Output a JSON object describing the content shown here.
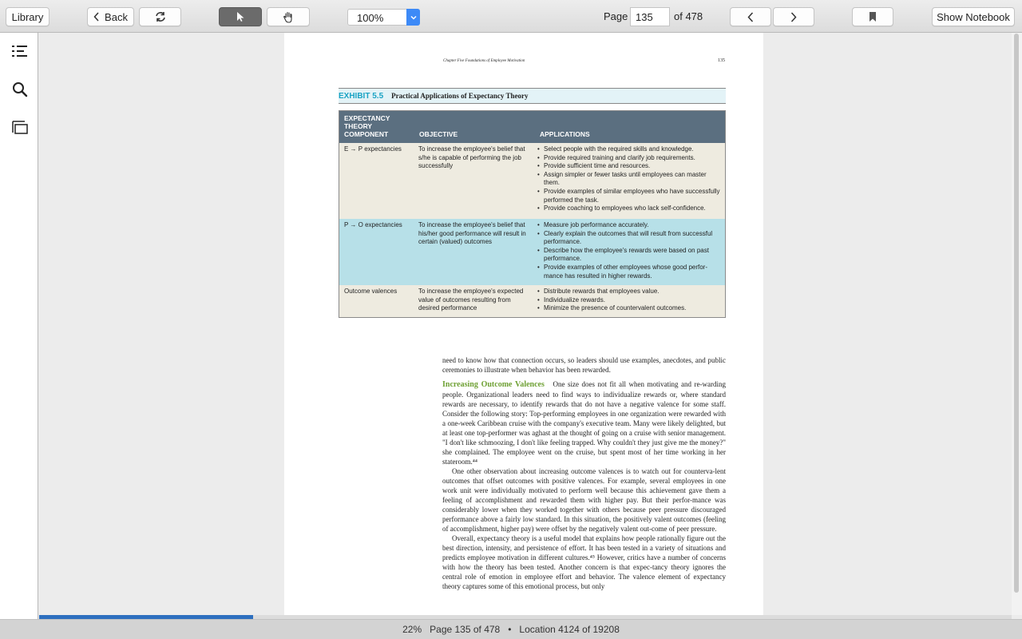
{
  "toolbar": {
    "library": "Library",
    "back": "Back",
    "zoom": "100%",
    "page_label": "Page",
    "page_value": "135",
    "page_of": "of 478",
    "show_notebook": "Show Notebook"
  },
  "book": {
    "running_head": "Chapter Five   Foundations of Employee Motivation",
    "page_number": "135",
    "exhibit_number": "EXHIBIT 5.5",
    "exhibit_title": "Practical Applications of Expectancy Theory",
    "table": {
      "headers": [
        "EXPECTANCY THEORY COMPONENT",
        "OBJECTIVE",
        "APPLICATIONS"
      ],
      "rows": [
        {
          "component": "E → P expectancies",
          "objective": "To increase the employee's belief that s/he is capable of performing the job successfully",
          "applications": [
            "Select people with the required skills and knowledge.",
            "Provide required training and clarify job requirements.",
            "Provide sufficient time and resources.",
            "Assign simpler or fewer tasks until employees can master them.",
            "Provide examples of similar employees who have successfully performed the task.",
            "Provide coaching to employees who lack self-confidence."
          ]
        },
        {
          "component": "P → O expectancies",
          "objective": "To increase the employee's belief that his/her good performance will result in certain (valued) outcomes",
          "applications": [
            "Measure job performance accurately.",
            "Clearly explain the outcomes that will result from successful performance.",
            "Describe how the employee's rewards were based on past performance.",
            "Provide examples of other employees whose good perfor-mance has resulted in higher rewards."
          ]
        },
        {
          "component": "Outcome valences",
          "objective": "To increase the employee's expected value of outcomes resulting from desired performance",
          "applications": [
            "Distribute rewards that employees value.",
            "Individualize rewards.",
            "Minimize the presence of countervalent outcomes."
          ]
        }
      ]
    },
    "para_intro": "need to know how that connection occurs, so leaders should use examples, anecdotes, and public ceremonies to illustrate when behavior has been rewarded.",
    "subhead": "Increasing Outcome Valences",
    "para_1": "One size does not fit all when motivating and re-warding people. Organizational leaders need to find ways to individualize rewards or, where standard rewards are necessary, to identify rewards that do not have a negative valence for some staff. Consider the following story: Top-performing employees in one organization were rewarded with a one-week Caribbean cruise with the company's executive team. Many were likely delighted, but at least one top-performer was aghast at the thought of going on a cruise with senior management. \"I don't like schmoozing, I don't like feeling trapped. Why couldn't they just give me the money?\" she complained. The employee went on the cruise, but spent most of her time working in her stateroom.⁴⁴",
    "para_2": "One other observation about increasing outcome valences is to watch out for counterva-lent outcomes that offset outcomes with positive valences. For example, several employees in one work unit were individually motivated to perform well because this achievement gave them a feeling of accomplishment and rewarded them with higher pay. But their perfor-mance was considerably lower when they worked together with others because peer pressure discouraged performance above a fairly low standard. In this situation, the positively valent outcomes (feeling of accomplishment, higher pay) were offset by the negatively valent out-come of peer pressure.",
    "para_3": "Overall, expectancy theory is a useful model that explains how people rationally figure out the best direction, intensity, and persistence of effort. It has been tested in a variety of situations and predicts employee motivation in different cultures.⁴⁵ However, critics have a number of concerns with how the theory has been tested. Another concern is that expec-tancy theory ignores the central role of emotion in employee effort and behavior. The valence element of expectancy theory captures some of this emotional process, but only"
  },
  "status": {
    "percent": "22%",
    "page_info": "Page 135 of 478",
    "separator": "•",
    "location": "Location 4124 of 19208",
    "progress_fraction": 0.22
  },
  "colors": {
    "accent_blue": "#3d8af7",
    "table_header": "#5b6f80",
    "row_tan": "#eeebe0",
    "row_blue": "#b7e0e8",
    "subhead_green": "#6ea033",
    "exhibit_cyan": "#1aa3c4"
  }
}
